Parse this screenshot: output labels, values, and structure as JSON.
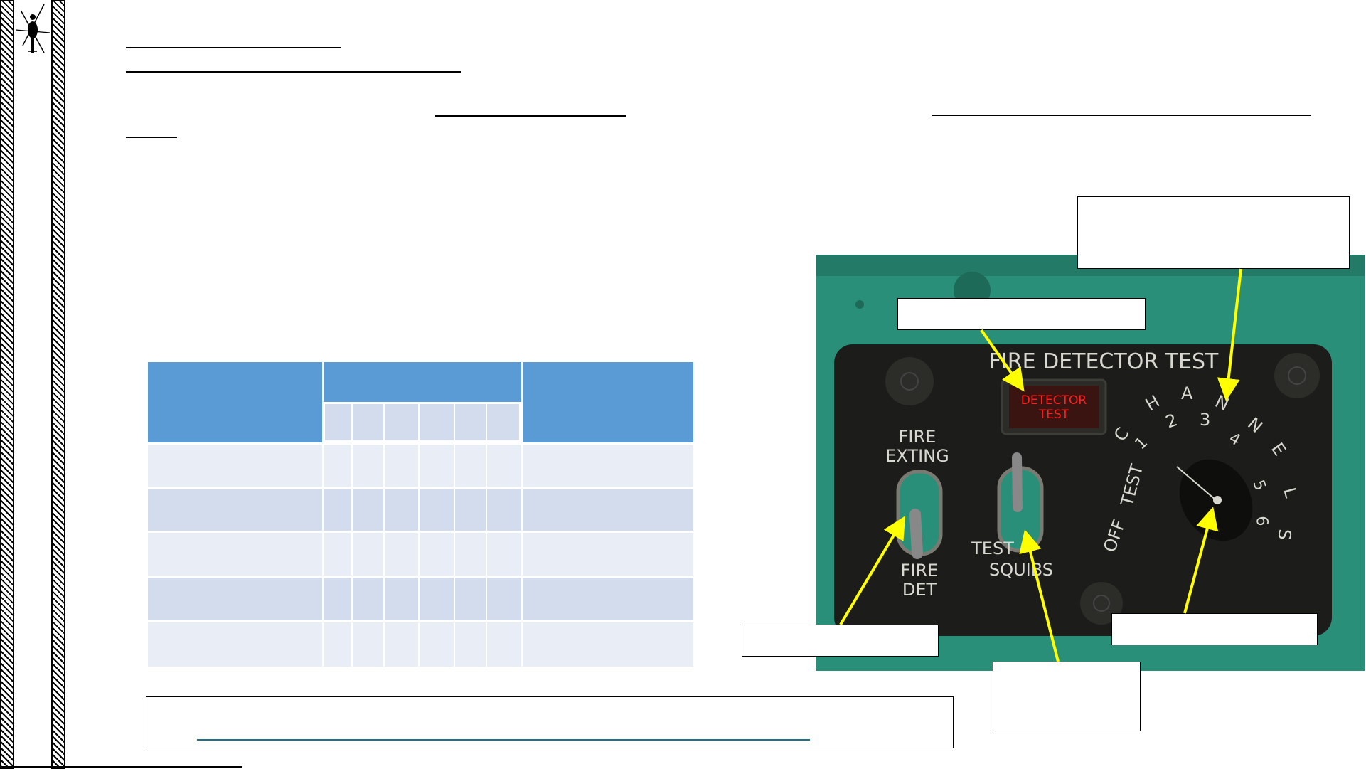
{
  "logo": {
    "icon": "helicopter-icon"
  },
  "panel": {
    "title": "FIRE DETECTOR TEST",
    "lamp_label_line1": "DETECTOR",
    "lamp_label_line2": "TEST",
    "left_switch_top_line1": "FIRE",
    "left_switch_top_line2": "EXTING",
    "left_switch_bottom_line1": "FIRE",
    "left_switch_bottom_line2": "DET",
    "test_label": "TEST",
    "squibs_label": "SQUIBS",
    "dial_positions": [
      "OFF",
      "TEST",
      "C",
      "1",
      "H",
      "2",
      "A",
      "3",
      "N",
      "4",
      "N",
      "E",
      "5",
      "L",
      "6",
      "S"
    ],
    "colors": {
      "panel_green": "#2a8f78",
      "panel_black": "#1c1c1a",
      "lamp_red": "#ff2020",
      "arrow_yellow": "#ffff00"
    }
  },
  "table": {
    "header_color": "#5b9bd5",
    "row_colors": [
      "#e9edf6",
      "#d2dcec"
    ],
    "rows": 5,
    "sub_columns": 6
  }
}
